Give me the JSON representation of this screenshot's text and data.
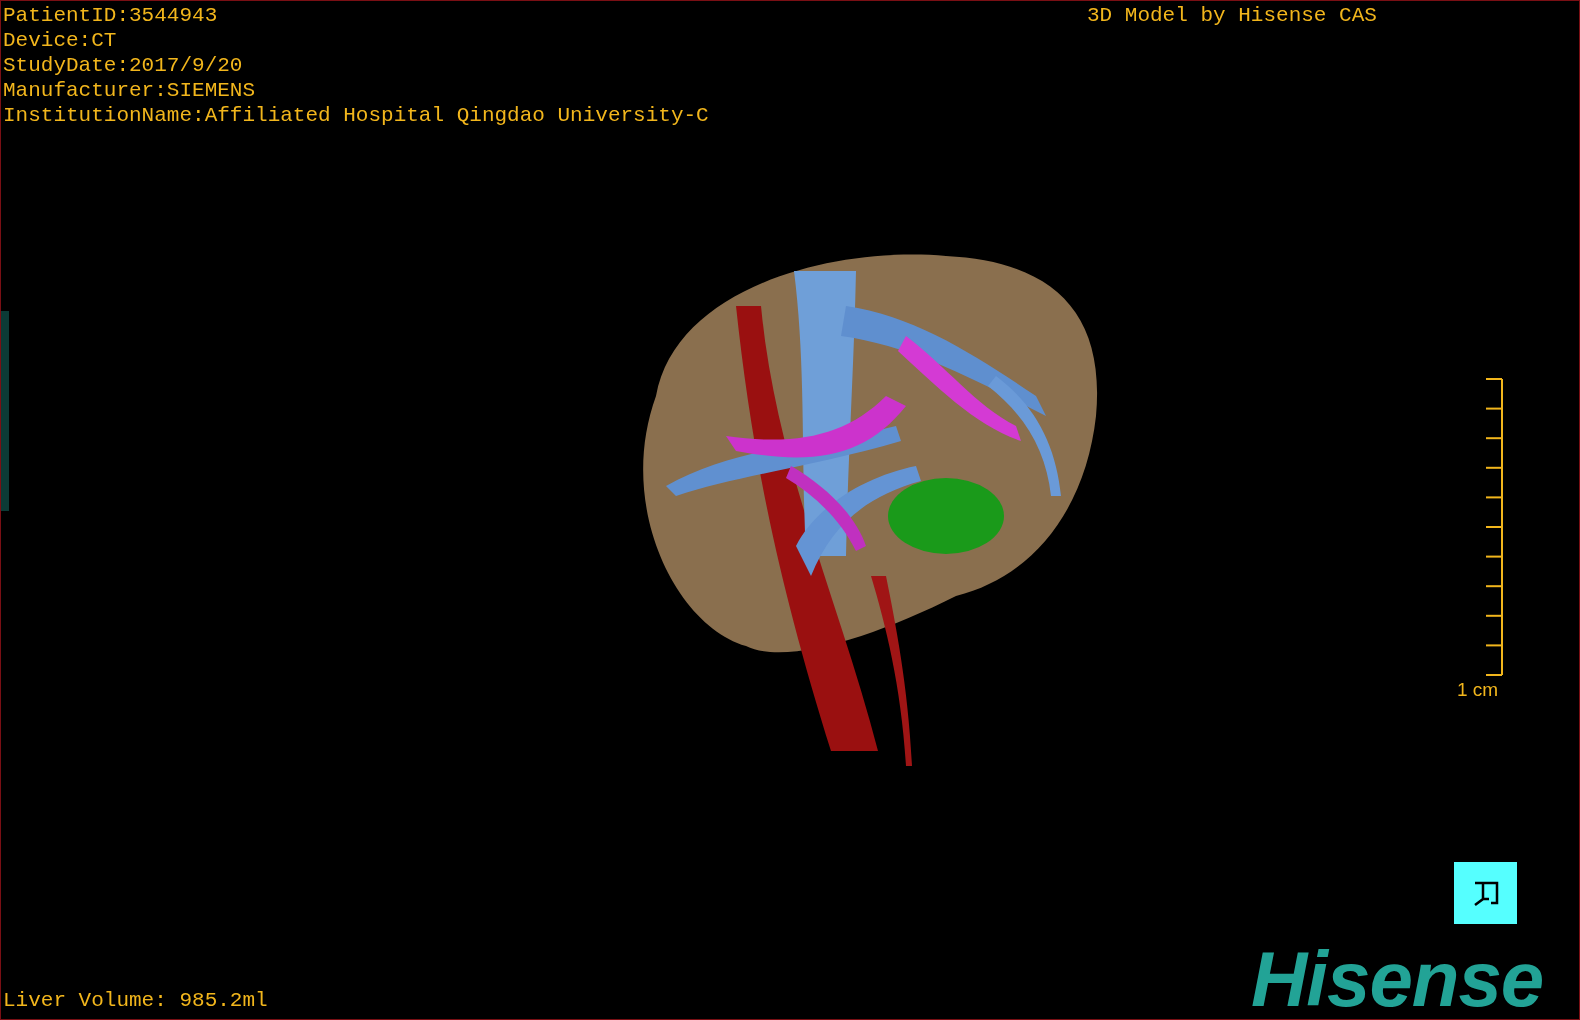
{
  "info_lines": [
    "PatientID:3544943",
    "Device:CT",
    "StudyDate:2017/9/20",
    "Manufacturer:SIEMENS",
    "InstitutionName:Affiliated Hospital Qingdao University-C"
  ],
  "title": "3D Model by Hisense CAS",
  "scale": {
    "label": "1 cm"
  },
  "liver_volume": "Liver Volume: 985.2ml",
  "logo": "Hisense"
}
